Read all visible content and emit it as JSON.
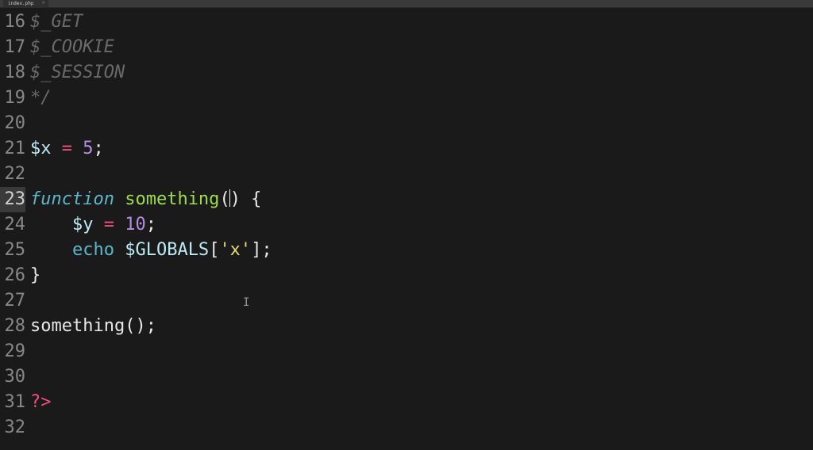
{
  "tab": {
    "filename": "index.php",
    "close_glyph": "×"
  },
  "gutter": {
    "start": 16,
    "count": 17,
    "active": 23
  },
  "code": {
    "lines": [
      {
        "n": 16,
        "tokens": [
          {
            "cls": "tok-comment",
            "t": "$_GET"
          }
        ]
      },
      {
        "n": 17,
        "tokens": [
          {
            "cls": "tok-comment",
            "t": "$_COOKIE"
          }
        ]
      },
      {
        "n": 18,
        "tokens": [
          {
            "cls": "tok-comment",
            "t": "$_SESSION"
          }
        ]
      },
      {
        "n": 19,
        "tokens": [
          {
            "cls": "tok-comment",
            "t": "*/"
          }
        ]
      },
      {
        "n": 20,
        "tokens": []
      },
      {
        "n": 21,
        "tokens": [
          {
            "cls": "tok-var",
            "t": "$x"
          },
          {
            "cls": "tok-plain",
            "t": " "
          },
          {
            "cls": "tok-op",
            "t": "="
          },
          {
            "cls": "tok-plain",
            "t": " "
          },
          {
            "cls": "tok-num",
            "t": "5"
          },
          {
            "cls": "tok-plain",
            "t": ";"
          }
        ]
      },
      {
        "n": 22,
        "tokens": []
      },
      {
        "n": 23,
        "tokens": [
          {
            "cls": "tok-keyword",
            "t": "function"
          },
          {
            "cls": "tok-plain",
            "t": " "
          },
          {
            "cls": "tok-funcname",
            "t": "something"
          },
          {
            "cls": "tok-plain",
            "t": "("
          },
          {
            "cls": "cursor",
            "t": ""
          },
          {
            "cls": "tok-plain",
            "t": ") {"
          }
        ]
      },
      {
        "n": 24,
        "tokens": [
          {
            "cls": "tok-plain",
            "t": "    "
          },
          {
            "cls": "tok-var",
            "t": "$y"
          },
          {
            "cls": "tok-plain",
            "t": " "
          },
          {
            "cls": "tok-op",
            "t": "="
          },
          {
            "cls": "tok-plain",
            "t": " "
          },
          {
            "cls": "tok-num",
            "t": "10"
          },
          {
            "cls": "tok-plain",
            "t": ";"
          }
        ]
      },
      {
        "n": 25,
        "tokens": [
          {
            "cls": "tok-plain",
            "t": "    "
          },
          {
            "cls": "tok-echo",
            "t": "echo"
          },
          {
            "cls": "tok-plain",
            "t": " "
          },
          {
            "cls": "tok-var",
            "t": "$GLOBALS"
          },
          {
            "cls": "tok-plain",
            "t": "["
          },
          {
            "cls": "tok-string",
            "t": "'x'"
          },
          {
            "cls": "tok-plain",
            "t": "];"
          }
        ]
      },
      {
        "n": 26,
        "tokens": [
          {
            "cls": "tok-plain",
            "t": "}"
          }
        ]
      },
      {
        "n": 27,
        "tokens": [],
        "ibeam": true
      },
      {
        "n": 28,
        "tokens": [
          {
            "cls": "tok-plain",
            "t": "something();"
          }
        ]
      },
      {
        "n": 29,
        "tokens": []
      },
      {
        "n": 30,
        "tokens": []
      },
      {
        "n": 31,
        "tokens": [
          {
            "cls": "tok-phpclose",
            "t": "?>"
          }
        ]
      },
      {
        "n": 32,
        "tokens": []
      }
    ]
  }
}
